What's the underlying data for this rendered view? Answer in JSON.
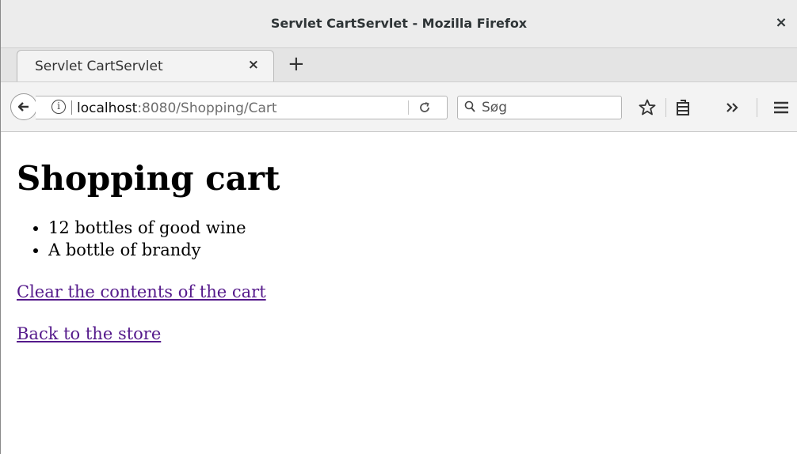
{
  "window": {
    "title": "Servlet CartServlet - Mozilla Firefox",
    "close_glyph": "×"
  },
  "tabs": [
    {
      "label": "Servlet CartServlet",
      "close_glyph": "×"
    }
  ],
  "newtab_glyph": "+",
  "navbar": {
    "url_host": "localhost",
    "url_rest": ":8080/Shopping/Cart",
    "search_placeholder": "Søg"
  },
  "icons": {
    "back": "back-arrow-icon",
    "info": "info-icon",
    "reload": "reload-icon",
    "search": "search-icon",
    "bookmark": "star-icon",
    "library": "library-icon",
    "overflow": "chevron-double-right-icon",
    "menu": "hamburger-menu-icon"
  },
  "page": {
    "title": "Shopping cart",
    "items": [
      "12 bottles of good wine",
      "A bottle of brandy"
    ],
    "clear_link": "Clear the contents of the cart",
    "back_link": "Back to the store"
  },
  "colors": {
    "visited_link": "#551a8b",
    "chrome_bg": "#ececec"
  }
}
